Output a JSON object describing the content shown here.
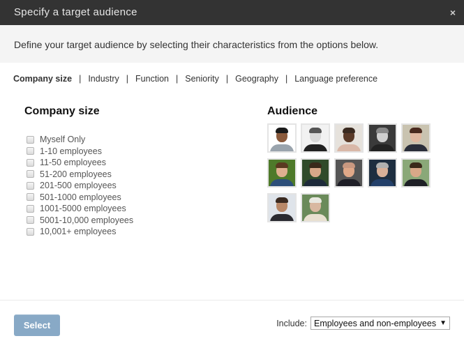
{
  "dialog": {
    "title": "Specify a target audience",
    "close_icon": "×",
    "intro": "Define your target audience by selecting their characteristics from the options below."
  },
  "tabs": [
    {
      "label": "Company size",
      "active": true
    },
    {
      "label": "Industry",
      "active": false
    },
    {
      "label": "Function",
      "active": false
    },
    {
      "label": "Seniority",
      "active": false
    },
    {
      "label": "Geography",
      "active": false
    },
    {
      "label": "Language preference",
      "active": false
    }
  ],
  "company_size": {
    "title": "Company size",
    "options": [
      {
        "label": "Myself Only",
        "checked": false
      },
      {
        "label": "1-10 employees",
        "checked": false
      },
      {
        "label": "11-50 employees",
        "checked": false
      },
      {
        "label": "51-200 employees",
        "checked": false
      },
      {
        "label": "201-500 employees",
        "checked": false
      },
      {
        "label": "501-1000 employees",
        "checked": false
      },
      {
        "label": "1001-5000 employees",
        "checked": false
      },
      {
        "label": "5001-10,000 employees",
        "checked": false
      },
      {
        "label": "10,001+ employees",
        "checked": false
      }
    ]
  },
  "audience": {
    "title": "Audience",
    "members": [
      {
        "name": "audience-member-1",
        "bg": "#ffffff",
        "skin": "#8a5a3c",
        "hair": "#1a1a1a",
        "shirt": "#9aa4ad"
      },
      {
        "name": "audience-member-2",
        "bg": "#f2f2f2",
        "skin": "#d8d8d8",
        "hair": "#555555",
        "shirt": "#222222"
      },
      {
        "name": "audience-member-3",
        "bg": "#e6e2dc",
        "skin": "#5a3a28",
        "hair": "#3a2a20",
        "shirt": "#d9b8a8"
      },
      {
        "name": "audience-member-4",
        "bg": "#3a3a3a",
        "skin": "#cfcfcf",
        "hair": "#8a8a8a",
        "shirt": "#222222"
      },
      {
        "name": "audience-member-5",
        "bg": "#c9c3b0",
        "skin": "#e0b8a0",
        "hair": "#4a2a1e",
        "shirt": "#2a2e3a"
      },
      {
        "name": "audience-member-6",
        "bg": "#4e7a2a",
        "skin": "#e0b090",
        "hair": "#5a3a20",
        "shirt": "#2d4f7a"
      },
      {
        "name": "audience-member-7",
        "bg": "#2f4a2a",
        "skin": "#d8a888",
        "hair": "#3a2a1a",
        "shirt": "#1d2a3a"
      },
      {
        "name": "audience-member-8",
        "bg": "#555555",
        "skin": "#e0a888",
        "hair": "#c89880",
        "shirt": "#1e1e26"
      },
      {
        "name": "audience-member-9",
        "bg": "#1e2e40",
        "skin": "#d8b098",
        "hair": "#b0b0b0",
        "shirt": "#23406a"
      },
      {
        "name": "audience-member-10",
        "bg": "#8aa878",
        "skin": "#d8a888",
        "hair": "#3a2a1a",
        "shirt": "#1e2026"
      },
      {
        "name": "audience-member-11",
        "bg": "#dfe4ea",
        "skin": "#b88868",
        "hair": "#3a2a20",
        "shirt": "#2a2a30"
      },
      {
        "name": "audience-member-12",
        "bg": "#6a8a5a",
        "skin": "#d8b8a0",
        "hair": "#e8e8e0",
        "shirt": "#e8e0d0"
      }
    ]
  },
  "footer": {
    "select_label": "Select",
    "include_label": "Include:",
    "include_value": "Employees and non-employees",
    "dropdown_arrow": "▼"
  }
}
